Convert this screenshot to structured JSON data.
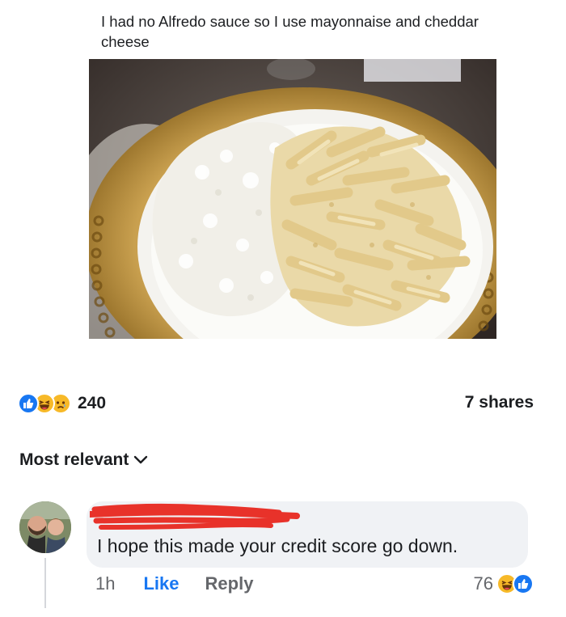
{
  "post": {
    "caption": "I had no Alfredo sauce so I use mayonnaise and cheddar cheese"
  },
  "reactions": {
    "icons": [
      "like-icon",
      "haha-icon",
      "sad-icon"
    ],
    "count": "240"
  },
  "shares": {
    "label": "7 shares"
  },
  "comments": {
    "sort_label": "Most relevant",
    "items": [
      {
        "author": "",
        "text": "I hope this made your credit score go down.",
        "time": "1h",
        "like_label": "Like",
        "reply_label": "Reply",
        "reaction_count": "76",
        "reaction_icons": [
          "haha-icon",
          "like-icon"
        ]
      }
    ]
  },
  "colors": {
    "link_blue": "#1877f2",
    "bubble_bg": "#f0f2f5",
    "muted_text": "#65676b",
    "redaction_red": "#e8322a"
  }
}
